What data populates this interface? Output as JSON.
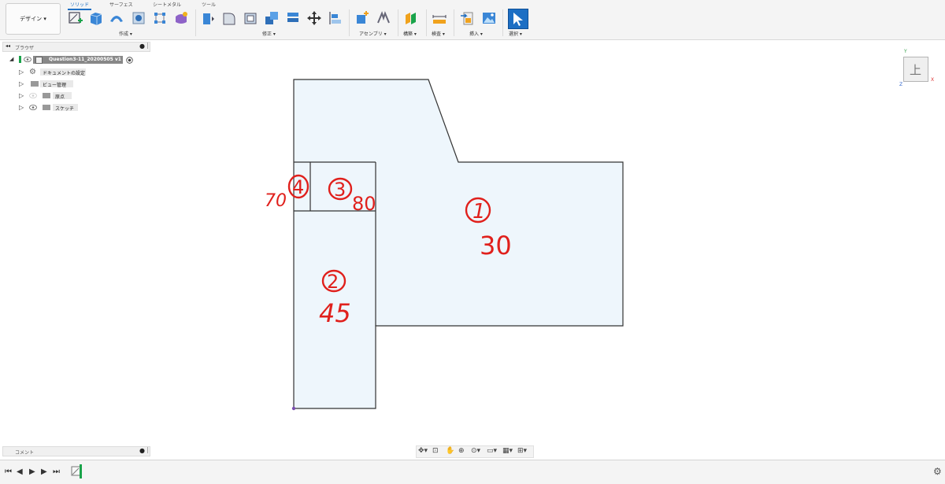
{
  "toolbar": {
    "design_label": "デザイン ▾",
    "tabs": [
      "ソリッド",
      "サーフェス",
      "シートメタル",
      "ツール"
    ],
    "groups": {
      "create": "作成 ▾",
      "modify": "修正 ▾",
      "assemble": "アセンブリ ▾",
      "construct": "構築 ▾",
      "inspect": "検査 ▾",
      "insert": "挿入 ▾",
      "select": "選択 ▾"
    }
  },
  "browser": {
    "title": "ブラウザ",
    "root": "Question3-11_20200505 v1",
    "items": [
      "ドキュメントの設定",
      "ビュー管理",
      "原点",
      "スケッチ"
    ]
  },
  "comments": {
    "title": "コメント"
  },
  "viewcube": {
    "face": "上",
    "axis_x": "X",
    "axis_y": "Y",
    "axis_z": "Z"
  },
  "annotations": {
    "n1": "1",
    "v1": "30",
    "n2": "2",
    "v2": "45",
    "n3": "3",
    "v3": "80",
    "n4": "4",
    "v4": "70"
  },
  "colors": {
    "accent": "#1d6fc4",
    "sketch_fill": "#eef6fc",
    "annotation": "#e0201c"
  }
}
